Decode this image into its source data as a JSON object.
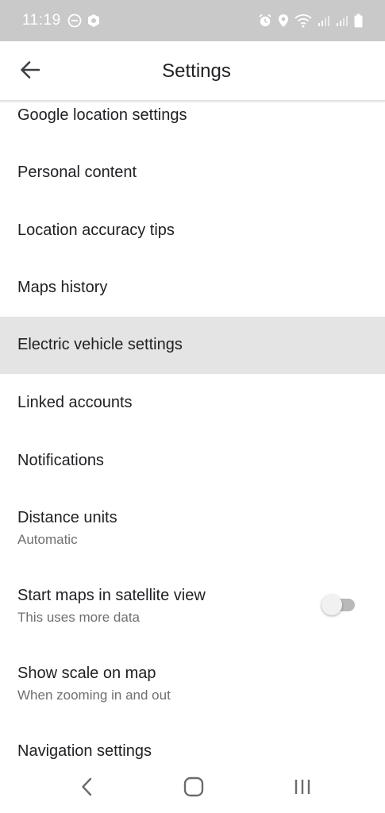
{
  "status_bar": {
    "time": "11:19",
    "left_icons": [
      "do-not-disturb-icon",
      "shield-app-icon"
    ],
    "right_icons": [
      "alarm-icon",
      "location-pin-icon",
      "wifi-icon",
      "signal-icon",
      "signal-icon",
      "battery-icon"
    ]
  },
  "app_bar": {
    "title": "Settings",
    "back_icon": "arrow-back-icon"
  },
  "settings": {
    "items": [
      {
        "title": "Google location settings"
      },
      {
        "title": "Personal content"
      },
      {
        "title": "Location accuracy tips"
      },
      {
        "title": "Maps history"
      },
      {
        "title": "Electric vehicle settings",
        "highlighted": true
      },
      {
        "title": "Linked accounts"
      },
      {
        "title": "Notifications"
      },
      {
        "title": "Distance units",
        "subtitle": "Automatic"
      },
      {
        "title": "Start maps in satellite view",
        "subtitle": "This uses more data",
        "toggle": false
      },
      {
        "title": "Show scale on map",
        "subtitle": "When zooming in and out"
      },
      {
        "title": "Navigation settings"
      }
    ]
  },
  "nav_bar": {
    "buttons": [
      "back-nav-icon",
      "home-nav-icon",
      "recents-nav-icon"
    ]
  },
  "colors": {
    "status_bar_bg": "#c9c9c9",
    "highlight_row_bg": "#e4e4e4",
    "primary_text": "#202124",
    "secondary_text": "#6f6f6f"
  }
}
